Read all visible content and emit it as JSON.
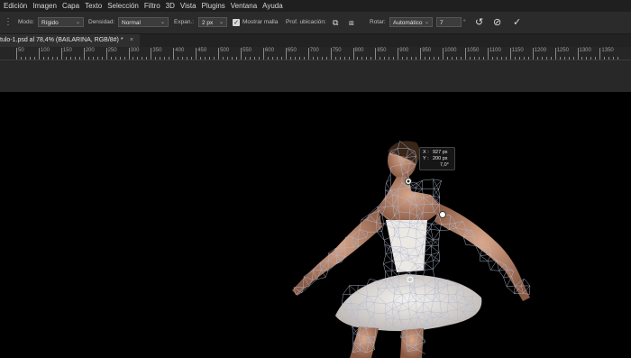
{
  "menubar": {
    "items": [
      "Edición",
      "Imagen",
      "Capa",
      "Texto",
      "Selección",
      "Filtro",
      "3D",
      "Vista",
      "Plugins",
      "Ventana",
      "Ayuda"
    ]
  },
  "options": {
    "mode_label": "Modo:",
    "mode_value": "Rígido",
    "density_label": "Densidad:",
    "density_value": "Normal",
    "expansion_label": "Expan.:",
    "expansion_value": "2 px",
    "show_mesh_label": "Mostrar malla",
    "show_mesh_checked": true,
    "depth_label": "Prof. ubicación:",
    "rotate_label": "Rotar:",
    "rotate_value": "Automático",
    "angle_value": "7",
    "angle_unit": "°"
  },
  "tab": {
    "title": "tulo-1.psd al 78,4% (BAILARINA, RGB/8#) *",
    "close": "×"
  },
  "ruler": {
    "labels": [
      "50",
      "100",
      "150",
      "200",
      "250",
      "300",
      "350",
      "400",
      "450",
      "500",
      "550",
      "600",
      "650",
      "700",
      "750",
      "800",
      "850",
      "900",
      "950",
      "1000",
      "1050",
      "1100",
      "1150",
      "1200",
      "1250",
      "1300",
      "1350"
    ]
  },
  "tooltip": {
    "x_label": "X :",
    "x_value": "927 px",
    "y_label": "Y :",
    "y_value": "200 px",
    "angle_value": "7,0°"
  },
  "colors": {
    "menubar_bg": "#1f1f1f",
    "options_bg": "#2b2b2b",
    "canvas_bg": "#000000",
    "mesh": "#b0b8d0"
  }
}
